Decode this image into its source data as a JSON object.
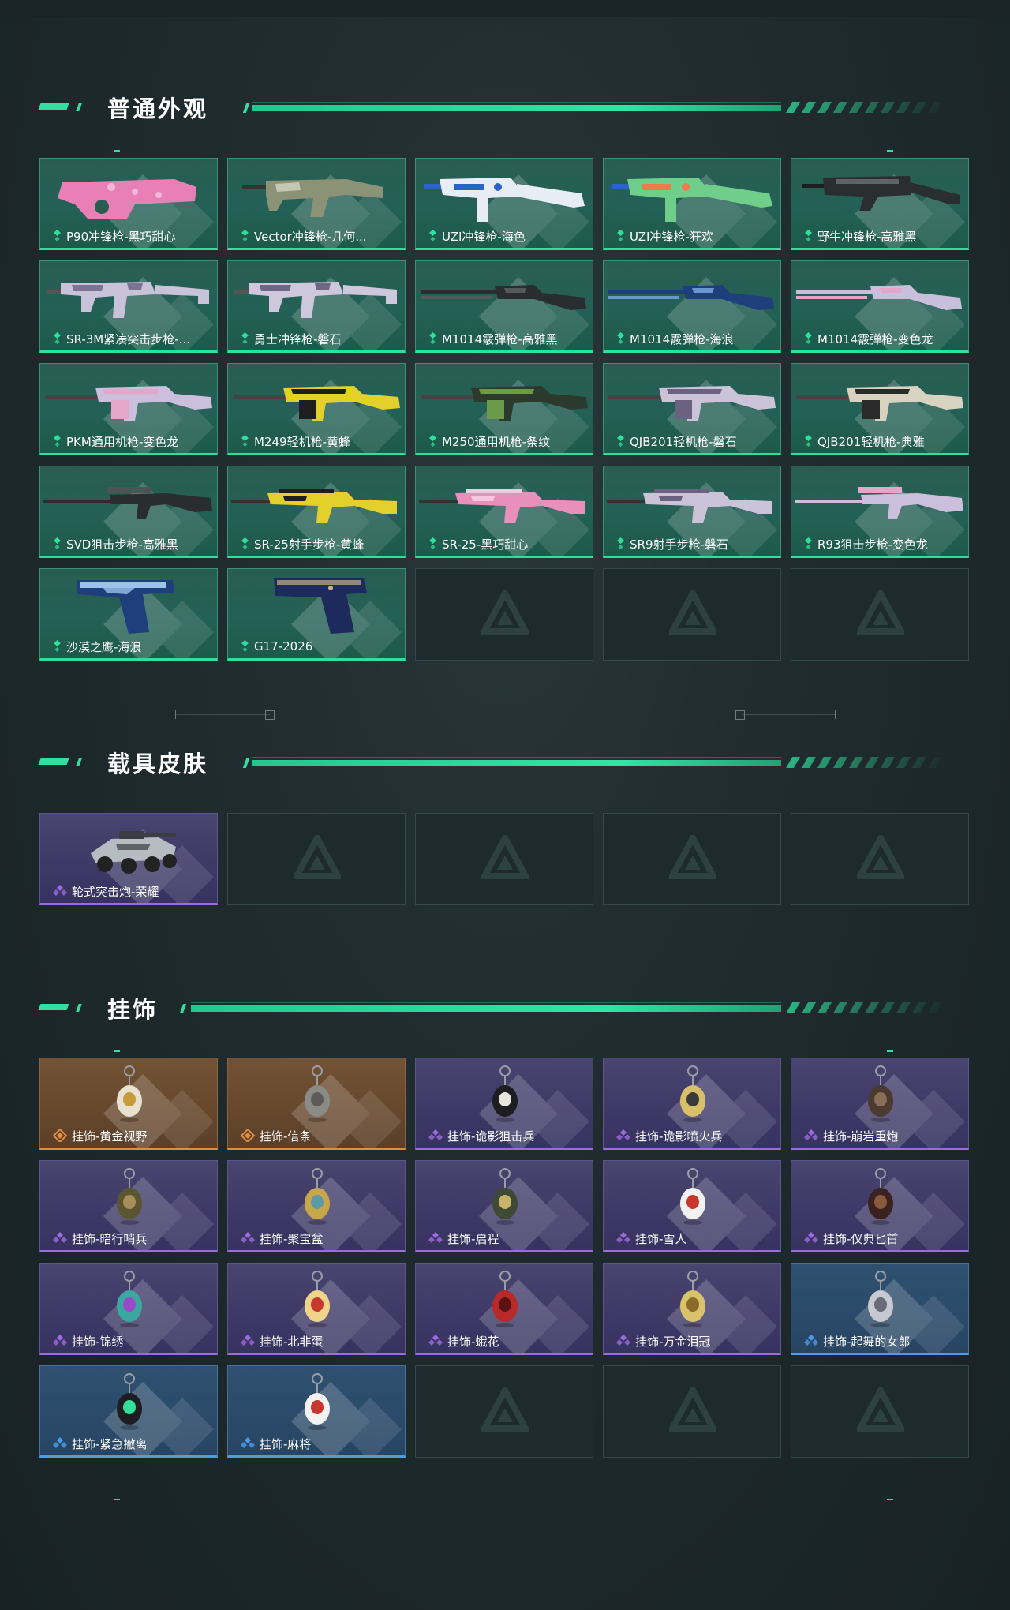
{
  "sections": [
    {
      "title": "普通外观",
      "items": [
        {
          "label": "P90冲锋枪-黑巧甜心",
          "rarity": "green",
          "art": "gun",
          "color": "#e87fb5",
          "accent": "#f2b8d6",
          "shape": "p90"
        },
        {
          "label": "Vector冲锋枪-几何...",
          "rarity": "green",
          "art": "gun",
          "color": "#8c9276",
          "accent": "#c5c7b2",
          "shape": "vector"
        },
        {
          "label": "UZI冲锋枪-海色",
          "rarity": "green",
          "art": "gun",
          "color": "#e8ecf4",
          "accent": "#2c63c8",
          "shape": "uzi"
        },
        {
          "label": "UZI冲锋枪-狂欢",
          "rarity": "green",
          "art": "gun",
          "color": "#6fcf8a",
          "accent": "#f07a4c",
          "shape": "uzi2"
        },
        {
          "label": "野牛冲锋枪-高雅黑",
          "rarity": "green",
          "art": "gun",
          "color": "#2a2e30",
          "accent": "#5d6366",
          "shape": "bizon"
        },
        {
          "label": "SR-3M紧凑突击步枪-...",
          "rarity": "green",
          "art": "gun",
          "color": "#c9c3d9",
          "accent": "#7e7394",
          "shape": "sr3m"
        },
        {
          "label": "勇士冲锋枪-磐石",
          "rarity": "green",
          "art": "gun",
          "color": "#cfc8dc",
          "accent": "#6f6684",
          "shape": "smg"
        },
        {
          "label": "M1014霰弹枪-高雅黑",
          "rarity": "green",
          "art": "gun",
          "color": "#2a2d30",
          "accent": "#55595c",
          "shape": "shotgun"
        },
        {
          "label": "M1014霰弹枪-海浪",
          "rarity": "green",
          "art": "gun",
          "color": "#1f3f7c",
          "accent": "#6a96cf",
          "shape": "shotgun"
        },
        {
          "label": "M1014霰弹枪-变色龙",
          "rarity": "green",
          "art": "gun",
          "color": "#c9bedc",
          "accent": "#e2a6c6",
          "shape": "shotgun"
        },
        {
          "label": "PKM通用机枪-变色龙",
          "rarity": "green",
          "art": "gun",
          "color": "#cbbfdd",
          "accent": "#e4a7c9",
          "shape": "lmg"
        },
        {
          "label": "M249轻机枪-黄蜂",
          "rarity": "green",
          "art": "gun",
          "color": "#e3d02a",
          "accent": "#1e1e1e",
          "shape": "lmg"
        },
        {
          "label": "M250通用机枪-条纹",
          "rarity": "green",
          "art": "gun",
          "color": "#2c3a2e",
          "accent": "#6a9a4a",
          "shape": "lmg"
        },
        {
          "label": "QJB201轻机枪-磐石",
          "rarity": "green",
          "art": "gun",
          "color": "#cbc4d8",
          "accent": "#6b6282",
          "shape": "lmg"
        },
        {
          "label": "QJB201轻机枪-典雅",
          "rarity": "green",
          "art": "gun",
          "color": "#d8d2c0",
          "accent": "#2a2a2a",
          "shape": "lmg"
        },
        {
          "label": "SVD狙击步枪-高雅黑",
          "rarity": "green",
          "art": "gun",
          "color": "#2a2d30",
          "accent": "#4f5356",
          "shape": "sniper"
        },
        {
          "label": "SR-25射手步枪-黄蜂",
          "rarity": "green",
          "art": "gun",
          "color": "#e3d02a",
          "accent": "#1e1e1e",
          "shape": "rifle"
        },
        {
          "label": "SR-25-黑巧甜心",
          "rarity": "green",
          "art": "gun",
          "color": "#e88fbc",
          "accent": "#f6c7de",
          "shape": "rifle"
        },
        {
          "label": "SR9射手步枪-磐石",
          "rarity": "green",
          "art": "gun",
          "color": "#cbc4d8",
          "accent": "#6b6282",
          "shape": "rifle"
        },
        {
          "label": "R93狙击步枪-变色龙",
          "rarity": "green",
          "art": "gun",
          "color": "#cbbfdd",
          "accent": "#e4a7c9",
          "shape": "sniper"
        },
        {
          "label": "沙漠之鹰-海浪",
          "rarity": "green",
          "art": "pistol",
          "color": "#1f3f7c",
          "accent": "#9cc3ec",
          "shape": "deagle"
        },
        {
          "label": "G17-2026",
          "rarity": "green",
          "art": "pistol",
          "color": "#1c2a5c",
          "accent": "#c9b17a",
          "shape": "glock"
        },
        {
          "empty": true
        },
        {
          "empty": true
        },
        {
          "empty": true
        }
      ]
    },
    {
      "title": "载具皮肤",
      "items": [
        {
          "label": "轮式突击炮-荣耀",
          "rarity": "purple",
          "art": "vehicle",
          "color": "#b7bcc2",
          "accent": "#3a3e44"
        },
        {
          "empty": true
        },
        {
          "empty": true
        },
        {
          "empty": true
        },
        {
          "empty": true
        }
      ]
    },
    {
      "title": "挂饰",
      "items": [
        {
          "label": "挂饰-黄金视野",
          "rarity": "orange",
          "art": "charm",
          "color": "#e9e1d0",
          "accent": "#c89a3a"
        },
        {
          "label": "挂饰-信条",
          "rarity": "orange",
          "art": "charm",
          "color": "#8a8a86",
          "accent": "#5b5a57"
        },
        {
          "label": "挂饰-诡影狙击兵",
          "rarity": "purple",
          "art": "charm",
          "color": "#1e1e22",
          "accent": "#e8e4e0"
        },
        {
          "label": "挂饰-诡影喷火兵",
          "rarity": "purple",
          "art": "charm",
          "color": "#d8c06a",
          "accent": "#3a3a3a"
        },
        {
          "label": "挂饰-崩岩重炮",
          "rarity": "purple",
          "art": "charm",
          "color": "#4a3a30",
          "accent": "#8a6e58"
        },
        {
          "label": "挂饰-暗行哨兵",
          "rarity": "purple",
          "art": "charm",
          "color": "#5a5632",
          "accent": "#a88e5a"
        },
        {
          "label": "挂饰-聚宝盆",
          "rarity": "purple",
          "art": "charm",
          "color": "#c8a64a",
          "accent": "#5b9aa6"
        },
        {
          "label": "挂饰-启程",
          "rarity": "purple",
          "art": "charm",
          "color": "#3f4a36",
          "accent": "#c8b36a"
        },
        {
          "label": "挂饰-雪人",
          "rarity": "purple",
          "art": "charm",
          "color": "#f2f2f2",
          "accent": "#c8372e"
        },
        {
          "label": "挂饰-仪典匕首",
          "rarity": "purple",
          "art": "charm",
          "color": "#3a2220",
          "accent": "#8a5a40"
        },
        {
          "label": "挂饰-锦绣",
          "rarity": "purple",
          "art": "charm",
          "color": "#3aa8a0",
          "accent": "#9a4ac8"
        },
        {
          "label": "挂饰-北非蛋",
          "rarity": "purple",
          "art": "charm",
          "color": "#f0d48a",
          "accent": "#c8372e"
        },
        {
          "label": "挂饰-蛾花",
          "rarity": "purple",
          "art": "charm",
          "color": "#b82a2a",
          "accent": "#5a1212"
        },
        {
          "label": "挂饰-万金泪冠",
          "rarity": "purple",
          "art": "charm",
          "color": "#d8c26a",
          "accent": "#8a6a2a"
        },
        {
          "label": "挂饰-起舞的女郎",
          "rarity": "blue",
          "art": "charm",
          "color": "#c8c8d0",
          "accent": "#6a6a78"
        },
        {
          "label": "挂饰-紧急撤离",
          "rarity": "blue",
          "art": "charm",
          "color": "#1e1e22",
          "accent": "#2fe09a"
        },
        {
          "label": "挂饰-麻将",
          "rarity": "blue",
          "art": "charm",
          "color": "#f2f2f2",
          "accent": "#c8372e"
        },
        {
          "empty": true
        },
        {
          "empty": true
        },
        {
          "empty": true
        }
      ]
    }
  ],
  "colors": {
    "green": "#2fe09a",
    "purple": "#9d6be0",
    "orange": "#e08d3c",
    "blue": "#4e9ce8"
  }
}
